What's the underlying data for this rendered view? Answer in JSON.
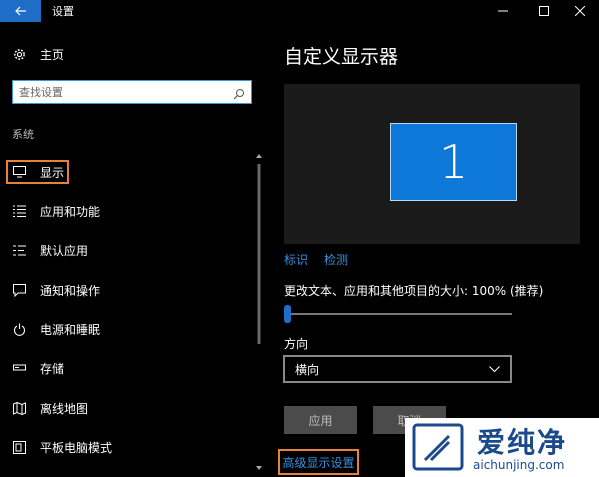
{
  "window": {
    "title": "设置",
    "back_icon": "arrow-left-icon",
    "minimize_icon": "minimize-icon",
    "maximize_icon": "maximize-icon",
    "close_icon": "close-icon",
    "accent": "#1e6ec8"
  },
  "sidebar": {
    "home": {
      "label": "主页",
      "icon": "gear-icon"
    },
    "search": {
      "placeholder": "查找设置",
      "value": "",
      "icon": "search-icon"
    },
    "section": "系统",
    "items": [
      {
        "label": "显示",
        "icon": "monitor-icon",
        "selected": true
      },
      {
        "label": "应用和功能",
        "icon": "list-icon"
      },
      {
        "label": "默认应用",
        "icon": "default-apps-icon"
      },
      {
        "label": "通知和操作",
        "icon": "message-icon"
      },
      {
        "label": "电源和睡眠",
        "icon": "power-icon"
      },
      {
        "label": "存储",
        "icon": "storage-icon"
      },
      {
        "label": "离线地图",
        "icon": "map-icon"
      },
      {
        "label": "平板电脑模式",
        "icon": "tablet-icon"
      }
    ],
    "highlight_color": "#e8823a"
  },
  "main": {
    "title": "自定义显示器",
    "monitor_number": "1",
    "identify_link": "标识",
    "detect_link": "检测",
    "scale_label": "更改文本、应用和其他项目的大小: 100% (推荐)",
    "scale_value_percent": 100,
    "orientation_label": "方向",
    "orientation_value": "横向",
    "apply_button": "应用",
    "cancel_button": "取消",
    "advanced_link": "高级显示设置"
  },
  "watermark": {
    "brand": "爱纯净",
    "url": "aichunjing.com"
  }
}
